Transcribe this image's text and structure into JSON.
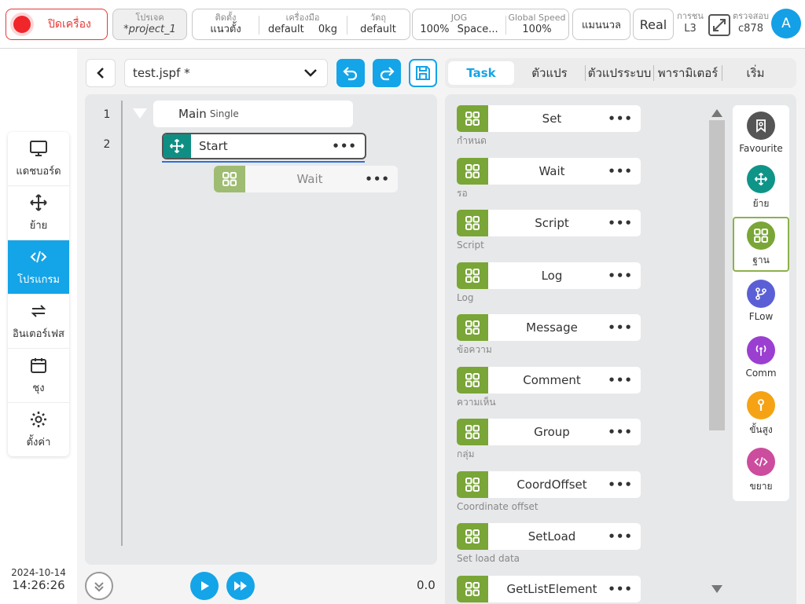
{
  "topbar": {
    "power_label": "ปิดเครื่อง",
    "project_caption": "โปรเจค",
    "project_value": "*project_1",
    "install_caption": "ติดตั้ง",
    "install_value": "แนวตั้ง",
    "tool_caption": "เครื่องมือ",
    "tool_value": "default",
    "tool_load": "0kg",
    "object_caption": "วัตถุ",
    "object_value": "default",
    "jog_caption": "JOG",
    "jog_value": "100%",
    "jog_space": "Space...",
    "speed_caption": "Global Speed",
    "speed_value": "100%",
    "mode_label": "แมนนวล",
    "real_label": "Real",
    "collision_caption": "การชน",
    "collision_value": "L3",
    "checksum_caption": "ตรวจสอบ",
    "checksum_value": "c878",
    "avatar_letter": "A"
  },
  "leftnav": {
    "items": [
      {
        "label": "แดชบอร์ด",
        "icon": "monitor-icon"
      },
      {
        "label": "ย้าย",
        "icon": "move-icon"
      },
      {
        "label": "โปรแกรม",
        "icon": "code-icon"
      },
      {
        "label": "อินเตอร์เฟส",
        "icon": "swap-icon"
      },
      {
        "label": "ชุง",
        "icon": "calendar-icon"
      },
      {
        "label": "ตั้งค่า",
        "icon": "gear-icon"
      }
    ],
    "active_index": 2
  },
  "datetime": {
    "date": "2024-10-14",
    "time": "14:26:26"
  },
  "editor": {
    "file_name": "test.jspf *",
    "lines": [
      "1",
      "2"
    ],
    "main_label": "Main",
    "main_mode": "Single",
    "start_label": "Start",
    "wait_label": "Wait",
    "speed_readout": "0.0"
  },
  "tabs": [
    {
      "label": "Task",
      "active": true
    },
    {
      "label": "ตัวแปร",
      "active": false
    },
    {
      "label": "ตัวแปรระบบ",
      "active": false
    },
    {
      "label": "พารามิเตอร์",
      "active": false
    },
    {
      "label": "เริ่ม",
      "active": false
    }
  ],
  "blocks": [
    {
      "label": "Set",
      "sub": "กำหนด"
    },
    {
      "label": "Wait",
      "sub": "รอ"
    },
    {
      "label": "Script",
      "sub": "Script"
    },
    {
      "label": "Log",
      "sub": "Log"
    },
    {
      "label": "Message",
      "sub": "ข้อความ"
    },
    {
      "label": "Comment",
      "sub": "ความเห็น"
    },
    {
      "label": "Group",
      "sub": "กลุ่ม"
    },
    {
      "label": "CoordOffset",
      "sub": "Coordinate offset"
    },
    {
      "label": "SetLoad",
      "sub": "Set load data"
    },
    {
      "label": "GetListElement",
      "sub": ""
    }
  ],
  "categories": [
    {
      "label": "Favourite",
      "icon": "bookmark-icon",
      "color": "#555555"
    },
    {
      "label": "ย้าย",
      "icon": "move-icon",
      "color": "#0f9488"
    },
    {
      "label": "ฐาน",
      "icon": "grid-icon",
      "color": "#79a636"
    },
    {
      "label": "FLow",
      "icon": "branch-icon",
      "color": "#5b5fd6"
    },
    {
      "label": "Comm",
      "icon": "antenna-icon",
      "color": "#9b3fd1"
    },
    {
      "label": "ขั้นสูง",
      "icon": "wrench-icon",
      "color": "#f5a314"
    },
    {
      "label": "ขยาย",
      "icon": "code-icon",
      "color": "#cc4c9e"
    }
  ],
  "colors": {
    "accent": "#14a4e8",
    "danger": "#e53935",
    "block_green": "#79a636"
  }
}
